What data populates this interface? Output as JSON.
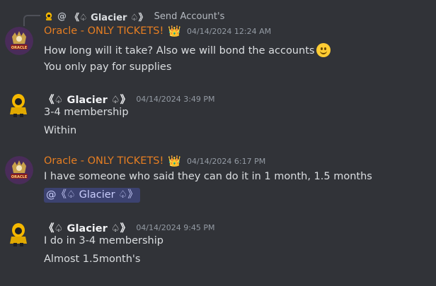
{
  "reply": {
    "at": "@",
    "name": "《♤ Glacier ♤》",
    "text": "Send Account's"
  },
  "messages": [
    {
      "author": "Oracle - ONLY TICKETS!",
      "author_color": "#e67e22",
      "badge": "👑",
      "timestamp": "04/14/2024 12:24 AM",
      "lines": [
        "How long will it take? Also we will bond the accounts",
        "You only pay for supplies"
      ]
    },
    {
      "author": "《♤ Glacier ♤》",
      "timestamp": "04/14/2024 3:49 PM",
      "lines": [
        "3-4 membership",
        "Within"
      ]
    },
    {
      "author": "Oracle - ONLY TICKETS!",
      "author_color": "#e67e22",
      "badge": "👑",
      "timestamp": "04/14/2024 6:17 PM",
      "lines": [
        "I have someone who said they can do it in 1 month, 1.5 months"
      ],
      "mention": "@《♤ Glacier ♤》"
    },
    {
      "author": "《♤ Glacier ♤》",
      "timestamp": "04/14/2024 9:45 PM",
      "lines": [
        "I do in 3-4 membership",
        "Almost 1.5month's"
      ]
    }
  ],
  "icons": {
    "oracle_avatar": "oracle-logo-avatar",
    "glacier_avatar": "yellow-hooded-figure-avatar",
    "crown": "crown-emoji",
    "smile": "slightly-smiling-face-emoji"
  },
  "colors": {
    "background": "#313338",
    "mention_bg": "#3c4270",
    "timestamp": "#949ba4"
  }
}
